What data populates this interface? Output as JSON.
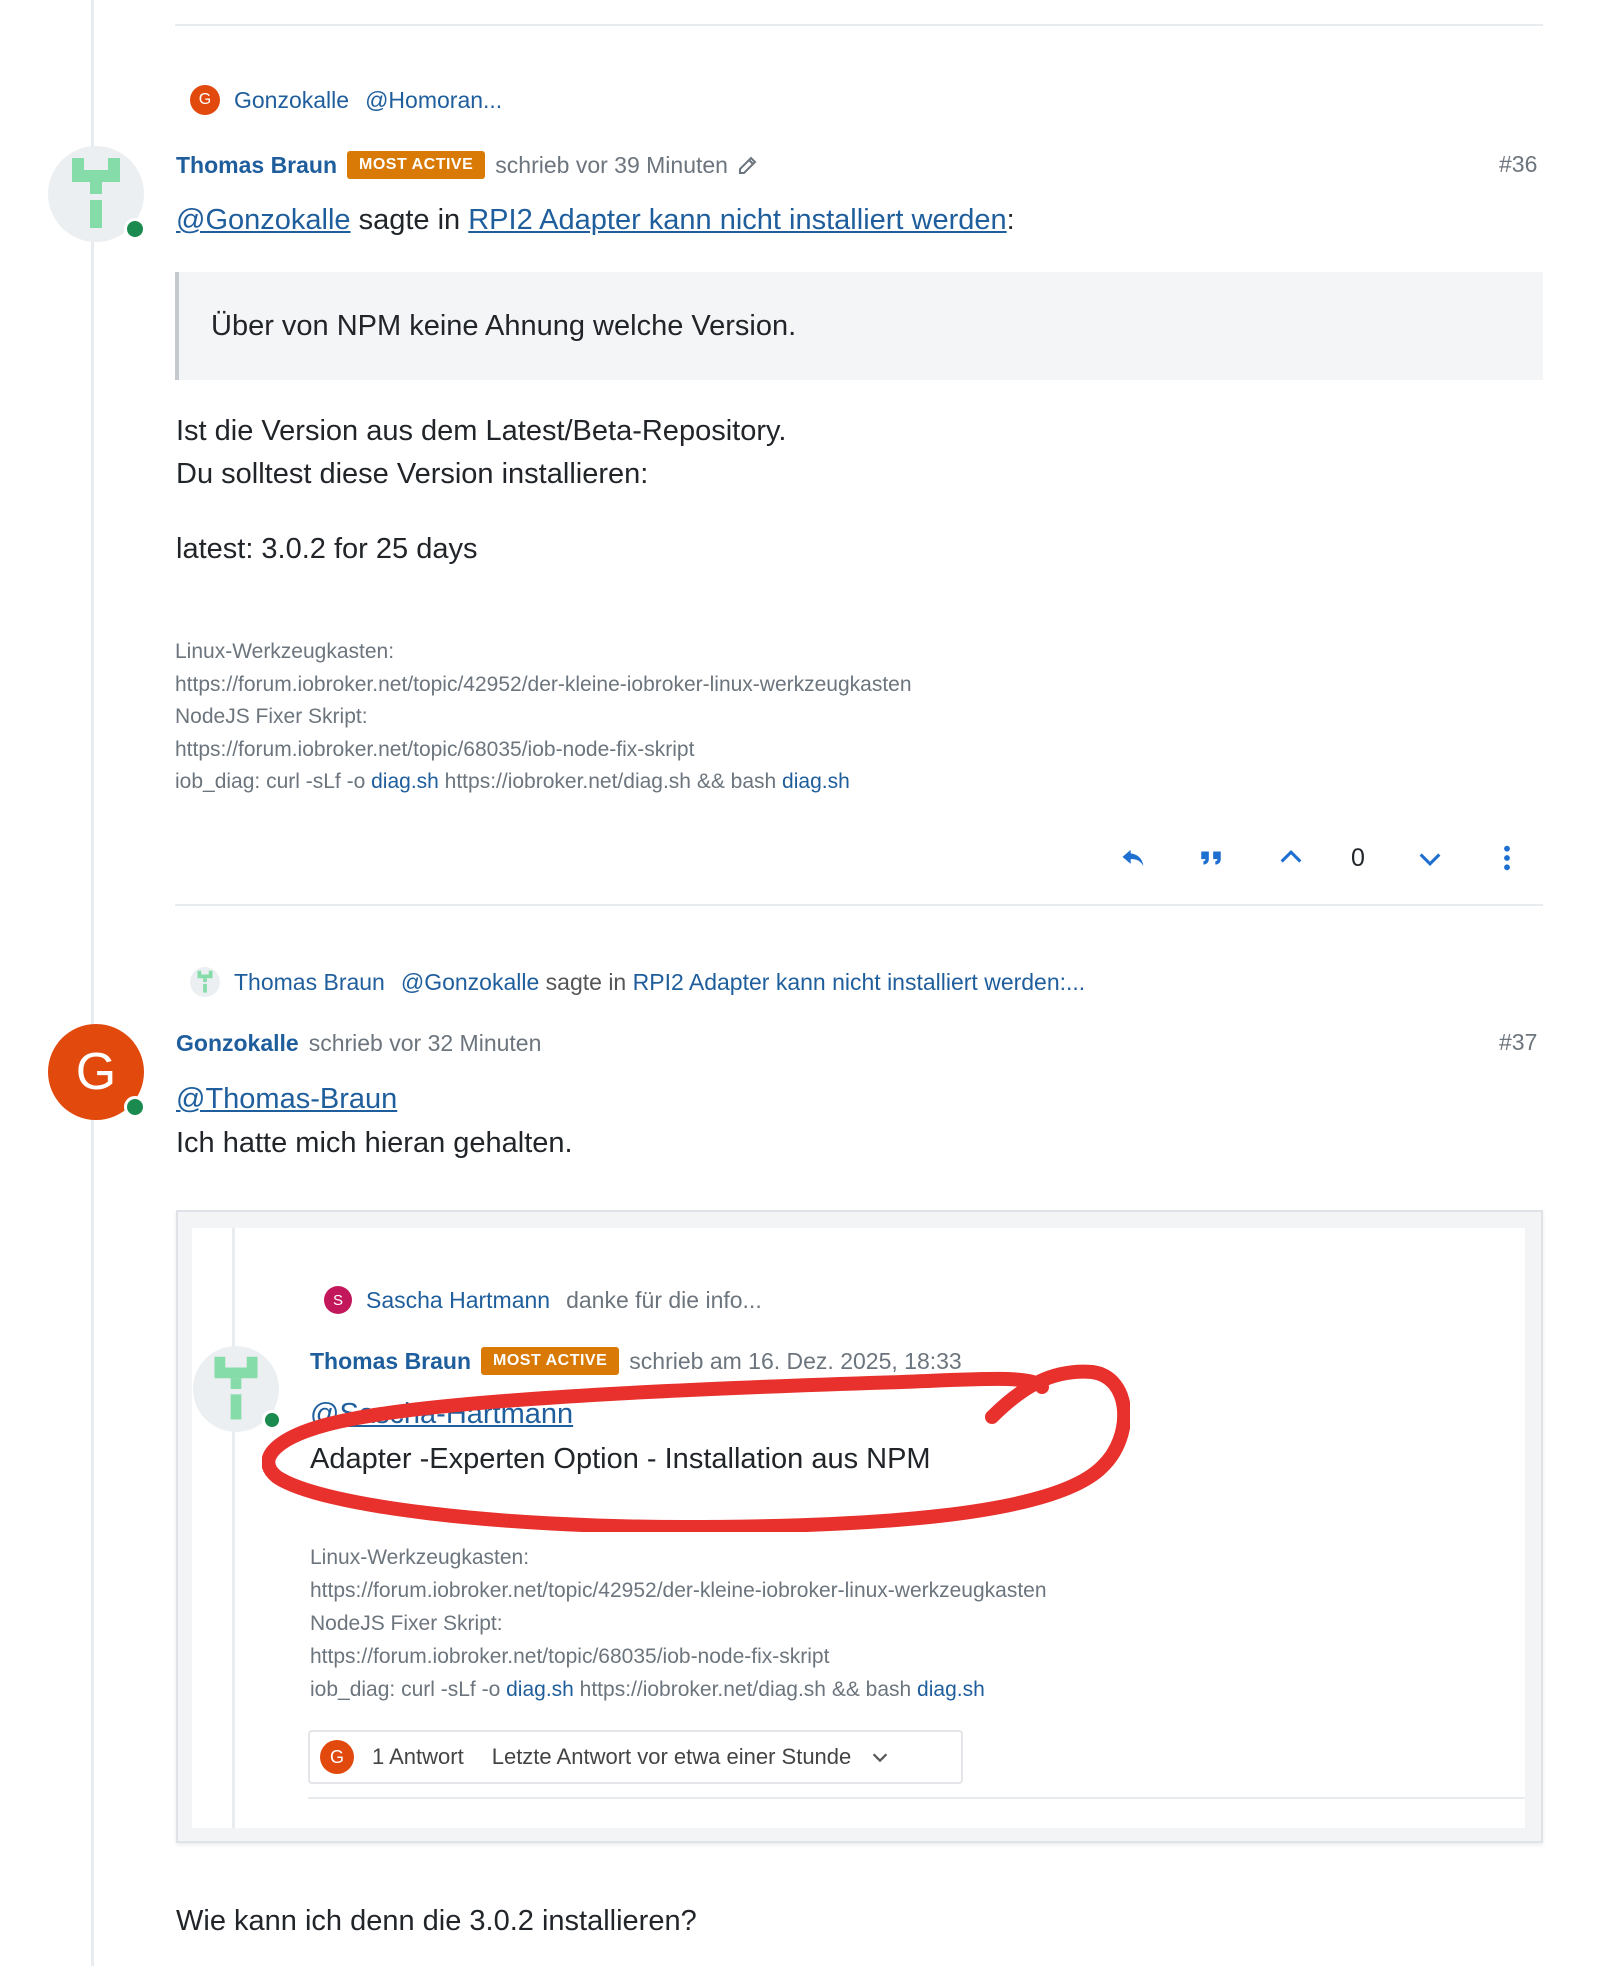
{
  "post36": {
    "parent": {
      "author": "Gonzokalle",
      "avatar_letter": "G",
      "avatar_color": "#e2490c",
      "snippet": "@Homoran..."
    },
    "author": "Thomas Braun",
    "badge": "MOST ACTIVE",
    "meta_text": "schrieb vor 39 Minuten",
    "number": "#36",
    "quote_header": {
      "mention": "@Gonzokalle",
      "says": "sagte in",
      "topic_link": "RPI2 Adapter kann nicht installiert werden",
      "colon": ":"
    },
    "quote_text": "Über von NPM keine Ahnung welche Version.",
    "body_lines": [
      "Ist die Version aus dem Latest/Beta-Repository.",
      "Du solltest diese Version installieren:",
      "latest: 3.0.2 for 25 days"
    ],
    "signature": {
      "line1": "Linux-Werkzeugkasten:",
      "line2": "https://forum.iobroker.net/topic/42952/der-kleine-iobroker-linux-werkzeugkasten",
      "line3": "NodeJS Fixer Skript:",
      "line4": "https://forum.iobroker.net/topic/68035/iob-node-fix-skript",
      "line5_pre": "iob_diag: curl -sLf -o ",
      "line5_link1": "diag.sh",
      "line5_mid": " https://iobroker.net/diag.sh && bash ",
      "line5_link2": "diag.sh"
    },
    "votes": "0"
  },
  "post37": {
    "parent": {
      "author": "Thomas Braun",
      "mention": "@Gonzokalle",
      "says": "sagte in",
      "snippet": "RPI2 Adapter kann nicht installiert werden:..."
    },
    "author": "Gonzokalle",
    "avatar_letter": "G",
    "avatar_color": "#e2490c",
    "meta_text": "schrieb vor 32 Minuten",
    "number": "#37",
    "mention": "@Thomas-Braun",
    "line1": "Ich hatte mich hieran gehalten.",
    "final_line": "Wie kann ich denn die 3.0.2 installieren?",
    "embedded": {
      "parent": {
        "author": "Sascha Hartmann",
        "avatar_letter": "S",
        "avatar_color": "#c2185b",
        "snippet": "danke für die info..."
      },
      "author": "Thomas Braun",
      "badge": "MOST ACTIVE",
      "meta_text": "schrieb am 16. Dez. 2025, 18:33",
      "mention": "@Sascha-Hartmann",
      "body": "Adapter -Experten Option - Installation aus NPM",
      "signature": {
        "line1": "Linux-Werkzeugkasten:",
        "line2": "https://forum.iobroker.net/topic/42952/der-kleine-iobroker-linux-werkzeugkasten",
        "line3": "NodeJS Fixer Skript:",
        "line4": "https://forum.iobroker.net/topic/68035/iob-node-fix-skript",
        "line5_pre": "iob_diag: curl -sLf -o ",
        "line5_link1": "diag.sh",
        "line5_mid": " https://iobroker.net/diag.sh && bash ",
        "line5_link2": "diag.sh"
      },
      "replies": {
        "avatar_letter": "G",
        "count": "1 Antwort",
        "last": "Letzte Antwort vor etwa einer Stunde"
      },
      "annotation_color": "#e8312c"
    }
  },
  "colors": {
    "link": "#1f5e9c",
    "badge": "#d97a06",
    "online": "#1b8a4e",
    "action": "#1f6fd1"
  }
}
